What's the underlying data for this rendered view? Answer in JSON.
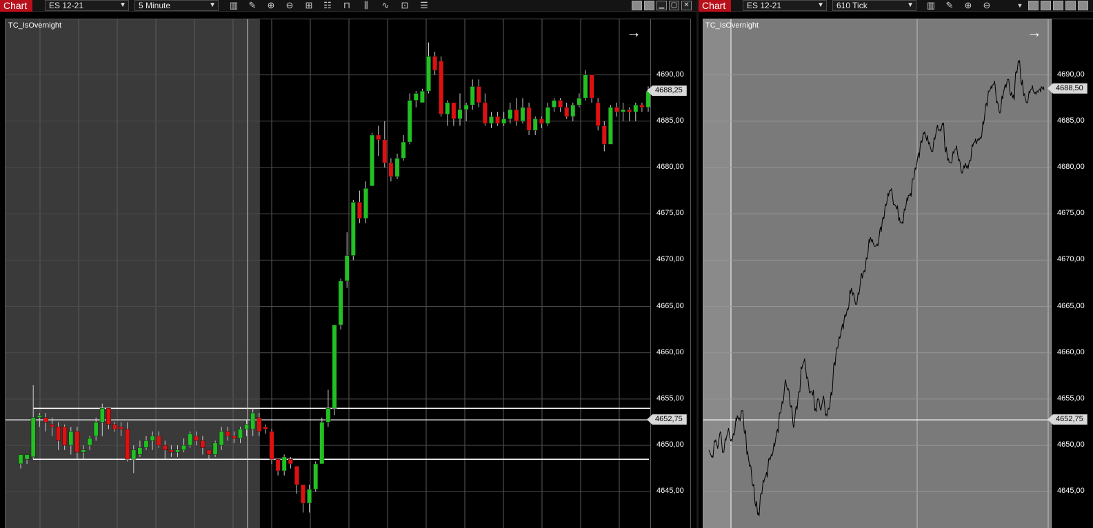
{
  "left_window": {
    "chart_tab": "Chart",
    "instrument": "ES 12-21",
    "interval": "5 Minute",
    "indicator_label": "TC_IsOvernight",
    "y_ticks": [
      "4690,00",
      "4685,00",
      "4680,00",
      "4675,00",
      "4670,00",
      "4665,00",
      "4660,00",
      "4655,00",
      "4650,00",
      "4645,00"
    ],
    "last_price": "4688,25",
    "line_price": "4652,75",
    "colors": {
      "up": "#22c022",
      "down": "#e01010",
      "overnight_shade": "#3a3a3a"
    }
  },
  "right_window": {
    "chart_tab": "Chart",
    "instrument": "ES 12-21",
    "interval": "610 Tick",
    "indicator_label": "TC_IsOvernight",
    "y_ticks": [
      "4690,00",
      "4685,00",
      "4680,00",
      "4675,00",
      "4670,00",
      "4665,00",
      "4660,00",
      "4655,00",
      "4650,00",
      "4645,00"
    ],
    "last_price": "4688,50",
    "line_price": "4652,75",
    "colors": {
      "background": "#7a7a7a",
      "line": "#000000"
    }
  },
  "chart_data": [
    {
      "type": "candlestick",
      "instrument": "ES 12-21",
      "interval": "5 Minute",
      "ylim": [
        4641,
        4696
      ],
      "grid": true,
      "candles": [
        [
          4648.0,
          4649.0,
          4647.5,
          4649.0
        ],
        [
          4648.5,
          4649.0,
          4648.0,
          4648.75
        ],
        [
          4648.75,
          4653.0,
          4648.5,
          4656.5
        ],
        [
          4653.0,
          4653.25,
          4652.0,
          4653.5
        ],
        [
          4653.0,
          4652.5,
          4651.5,
          4653.5
        ],
        [
          4652.25,
          4652.0,
          4651.0,
          4653.0
        ],
        [
          4652.0,
          4650.5,
          4649.5,
          4652.5
        ],
        [
          4652.0,
          4650.0,
          4649.5,
          4652.25
        ],
        [
          4650.0,
          4651.5,
          4649.0,
          4652.0
        ],
        [
          4651.5,
          4649.25,
          4648.5,
          4652.0
        ],
        [
          4649.25,
          4649.5,
          4648.5,
          4650.0
        ],
        [
          4650.0,
          4650.75,
          4649.5,
          4651.0
        ],
        [
          4651.0,
          4652.5,
          4650.5,
          4653.0
        ],
        [
          4652.5,
          4654.0,
          4651.0,
          4654.5
        ],
        [
          4654.0,
          4652.25,
          4651.75,
          4654.0
        ],
        [
          4652.25,
          4651.75,
          4651.5,
          4652.5
        ],
        [
          4652.0,
          4651.75,
          4651.0,
          4652.5
        ],
        [
          4651.75,
          4648.5,
          4648.25,
          4652.5
        ],
        [
          4648.5,
          4649.5,
          4647.0,
          4650.0
        ],
        [
          4649.0,
          4649.75,
          4648.75,
          4650.5
        ],
        [
          4649.75,
          4650.5,
          4649.5,
          4651.0
        ],
        [
          4650.5,
          4651.0,
          4649.5,
          4651.5
        ],
        [
          4651.0,
          4650.0,
          4649.75,
          4651.5
        ],
        [
          4650.0,
          4649.5,
          4648.5,
          4650.5
        ],
        [
          4649.5,
          4649.25,
          4648.75,
          4650.0
        ],
        [
          4649.25,
          4649.5,
          4648.75,
          4650.0
        ],
        [
          4649.5,
          4650.0,
          4649.25,
          4650.75
        ],
        [
          4650.0,
          4651.25,
          4649.75,
          4651.5
        ],
        [
          4651.0,
          4650.5,
          4650.0,
          4651.5
        ],
        [
          4650.5,
          4649.75,
          4649.0,
          4651.0
        ],
        [
          4649.5,
          4649.0,
          4648.5,
          4649.5
        ],
        [
          4649.0,
          4650.25,
          4648.75,
          4650.5
        ],
        [
          4650.0,
          4651.5,
          4649.5,
          4652.0
        ],
        [
          4651.5,
          4651.0,
          4650.5,
          4652.0
        ],
        [
          4651.0,
          4650.75,
          4650.25,
          4651.5
        ],
        [
          4650.75,
          4651.75,
          4650.25,
          4652.0
        ],
        [
          4651.75,
          4652.25,
          4651.0,
          4652.75
        ],
        [
          4651.75,
          4653.5,
          4651.0,
          4654.0
        ],
        [
          4653.0,
          4651.5,
          4651.0,
          4653.5
        ],
        [
          4652.0,
          4651.75,
          4651.25,
          4652.25
        ],
        [
          4651.5,
          4648.5,
          4648.0,
          4651.75
        ],
        [
          4648.5,
          4647.25,
          4646.75,
          4648.5
        ],
        [
          4647.25,
          4648.75,
          4646.75,
          4649.0
        ],
        [
          4648.5,
          4648.0,
          4647.5,
          4648.75
        ],
        [
          4647.75,
          4645.75,
          4644.75,
          4647.75
        ],
        [
          4645.75,
          4643.75,
          4642.75,
          4645.75
        ],
        [
          4643.75,
          4645.25,
          4642.75,
          4645.75
        ],
        [
          4645.25,
          4648.0,
          4645.0,
          4648.25
        ],
        [
          4648.0,
          4652.5,
          4648.0,
          4653.0
        ],
        [
          4652.5,
          4654.0,
          4652.0,
          4656.0
        ],
        [
          4654.0,
          4663.0,
          4653.25,
          4663.0
        ],
        [
          4663.0,
          4667.75,
          4662.5,
          4668.0
        ],
        [
          4667.75,
          4670.5,
          4667.0,
          4673.0
        ],
        [
          4670.5,
          4676.25,
          4670.0,
          4676.5
        ],
        [
          4676.25,
          4674.5,
          4674.0,
          4677.5
        ],
        [
          4674.5,
          4677.75,
          4674.0,
          4678.5
        ],
        [
          4678.0,
          4683.5,
          4678.0,
          4683.75
        ],
        [
          4683.5,
          4683.0,
          4681.25,
          4684.5
        ],
        [
          4683.0,
          4680.5,
          4680.0,
          4685.0
        ],
        [
          4680.5,
          4679.0,
          4678.5,
          4681.0
        ],
        [
          4679.0,
          4681.0,
          4678.75,
          4681.5
        ],
        [
          4681.0,
          4682.75,
          4680.75,
          4683.5
        ],
        [
          4682.75,
          4687.25,
          4682.5,
          4688.0
        ],
        [
          4687.25,
          4688.0,
          4686.5,
          4688.25
        ],
        [
          4687.0,
          4688.25,
          4687.0,
          4688.5
        ],
        [
          4688.25,
          4692.0,
          4688.0,
          4693.5
        ],
        [
          4692.0,
          4690.5,
          4690.0,
          4692.5
        ],
        [
          4691.5,
          4685.75,
          4685.5,
          4692.0
        ],
        [
          4685.75,
          4687.0,
          4684.5,
          4687.25
        ],
        [
          4687.0,
          4685.25,
          4684.5,
          4687.0
        ],
        [
          4685.25,
          4686.25,
          4684.5,
          4688.0
        ],
        [
          4686.25,
          4686.75,
          4685.0,
          4687.0
        ],
        [
          4686.75,
          4688.75,
          4686.25,
          4689.5
        ],
        [
          4688.75,
          4687.0,
          4686.5,
          4689.5
        ],
        [
          4687.0,
          4684.75,
          4684.5,
          4688.0
        ],
        [
          4684.75,
          4685.5,
          4684.25,
          4686.0
        ],
        [
          4685.5,
          4684.75,
          4684.5,
          4686.0
        ],
        [
          4684.75,
          4685.25,
          4684.5,
          4686.0
        ],
        [
          4685.25,
          4686.25,
          4684.75,
          4687.0
        ],
        [
          4686.25,
          4685.0,
          4684.5,
          4687.5
        ],
        [
          4685.0,
          4686.5,
          4684.75,
          4687.5
        ],
        [
          4686.5,
          4684.0,
          4683.5,
          4687.0
        ],
        [
          4684.0,
          4685.25,
          4683.5,
          4685.5
        ],
        [
          4685.25,
          4684.75,
          4684.25,
          4685.5
        ],
        [
          4684.75,
          4686.5,
          4684.5,
          4687.0
        ],
        [
          4686.5,
          4687.25,
          4686.0,
          4687.5
        ],
        [
          4687.25,
          4686.5,
          4686.0,
          4687.5
        ],
        [
          4686.5,
          4685.5,
          4685.25,
          4687.0
        ],
        [
          4685.5,
          4686.75,
          4685.0,
          4687.0
        ],
        [
          4686.75,
          4687.5,
          4686.5,
          4688.0
        ],
        [
          4687.5,
          4690.0,
          4687.25,
          4690.5
        ],
        [
          4690.0,
          4687.5,
          4687.0,
          4690.0
        ],
        [
          4687.0,
          4684.5,
          4684.0,
          4687.5
        ],
        [
          4684.5,
          4682.5,
          4681.75,
          4685.0
        ],
        [
          4682.5,
          4686.5,
          4682.5,
          4686.75
        ],
        [
          4686.5,
          4686.0,
          4685.5,
          4687.0
        ],
        [
          4686.0,
          4686.25,
          4685.0,
          4687.0
        ],
        [
          4686.25,
          4686.0,
          4685.0,
          4686.5
        ],
        [
          4686.0,
          4686.75,
          4685.0,
          4687.0
        ],
        [
          4686.75,
          4686.5,
          4686.0,
          4687.0
        ],
        [
          4686.5,
          4688.25,
          4686.0,
          4688.75
        ]
      ],
      "overnight_bars": 40,
      "last_price": 4688.25,
      "horizontal_line": 4652.75
    },
    {
      "type": "line",
      "instrument": "ES 12-21",
      "interval": "610 Tick",
      "ylim": [
        4641,
        4696
      ],
      "grid": true,
      "x": [
        0,
        4,
        8,
        12,
        16,
        20,
        24,
        28,
        32,
        36,
        40,
        44,
        48,
        52,
        56,
        60,
        64,
        68,
        72,
        76,
        80,
        84,
        88,
        92,
        96,
        100,
        104,
        108,
        112,
        116,
        120,
        124,
        128,
        132,
        136,
        140,
        144,
        148,
        152,
        156,
        160,
        164,
        168,
        172,
        176,
        180,
        184,
        188,
        192,
        196,
        200,
        204,
        208,
        212,
        216,
        220,
        224,
        228,
        232,
        236,
        240,
        244,
        248,
        252,
        256,
        260,
        264,
        268,
        272,
        276,
        280,
        284,
        288,
        292,
        296,
        300,
        304,
        308,
        312,
        316,
        320,
        324,
        328,
        332,
        336,
        340,
        344,
        348,
        352,
        356,
        360,
        364,
        368,
        372,
        376,
        380,
        384,
        388,
        392,
        396,
        400,
        404,
        408,
        412,
        416,
        420,
        424,
        428,
        432,
        436,
        440,
        444,
        448,
        452,
        456,
        460,
        464,
        468,
        472,
        476,
        480,
        484,
        488,
        492
      ],
      "y": [
        4649.5,
        4648.75,
        4650.5,
        4650.0,
        4651.25,
        4649.25,
        4650.75,
        4651.5,
        4650.5,
        4651.25,
        4653.0,
        4652.75,
        4653.75,
        4651.5,
        4649.0,
        4647.75,
        4645.75,
        4643.75,
        4642.5,
        4644.75,
        4646.25,
        4646.75,
        4648.5,
        4649.0,
        4650.25,
        4651.5,
        4653.5,
        4654.75,
        4656.75,
        4656.0,
        4654.25,
        4652.25,
        4654.0,
        4655.75,
        4658.5,
        4659.0,
        4657.25,
        4655.75,
        4655.75,
        4653.75,
        4655.0,
        4654.0,
        4655.0,
        4653.25,
        4654.0,
        4655.75,
        4658.75,
        4660.5,
        4661.75,
        4662.75,
        4664.0,
        4664.75,
        4666.75,
        4666.25,
        4665.25,
        4666.5,
        4668.25,
        4668.75,
        4670.25,
        4672.25,
        4672.0,
        4671.5,
        4671.75,
        4673.25,
        4674.5,
        4676.0,
        4677.25,
        4677.5,
        4676.0,
        4675.75,
        4674.25,
        4674.0,
        4675.5,
        4676.75,
        4677.0,
        4678.75,
        4680.0,
        4681.25,
        4682.75,
        4683.75,
        4683.25,
        4682.5,
        4681.75,
        4683.25,
        4684.25,
        4684.0,
        4684.75,
        4682.0,
        4680.75,
        4680.5,
        4681.75,
        4682.0,
        4680.75,
        4679.5,
        4680.25,
        4680.0,
        4680.75,
        4682.5,
        4682.75,
        4683.0,
        4683.25,
        4685.0,
        4686.75,
        4688.25,
        4688.75,
        4689.0,
        4687.0,
        4686.0,
        4687.75,
        4688.75,
        4689.5,
        4688.0,
        4687.5,
        4690.25,
        4691.5,
        4689.25,
        4687.75,
        4687.0,
        4688.25,
        4688.5,
        4688.0,
        4688.25,
        4688.5,
        4688.5
      ],
      "last_price": 4688.5,
      "horizontal_line": 4652.75
    }
  ]
}
